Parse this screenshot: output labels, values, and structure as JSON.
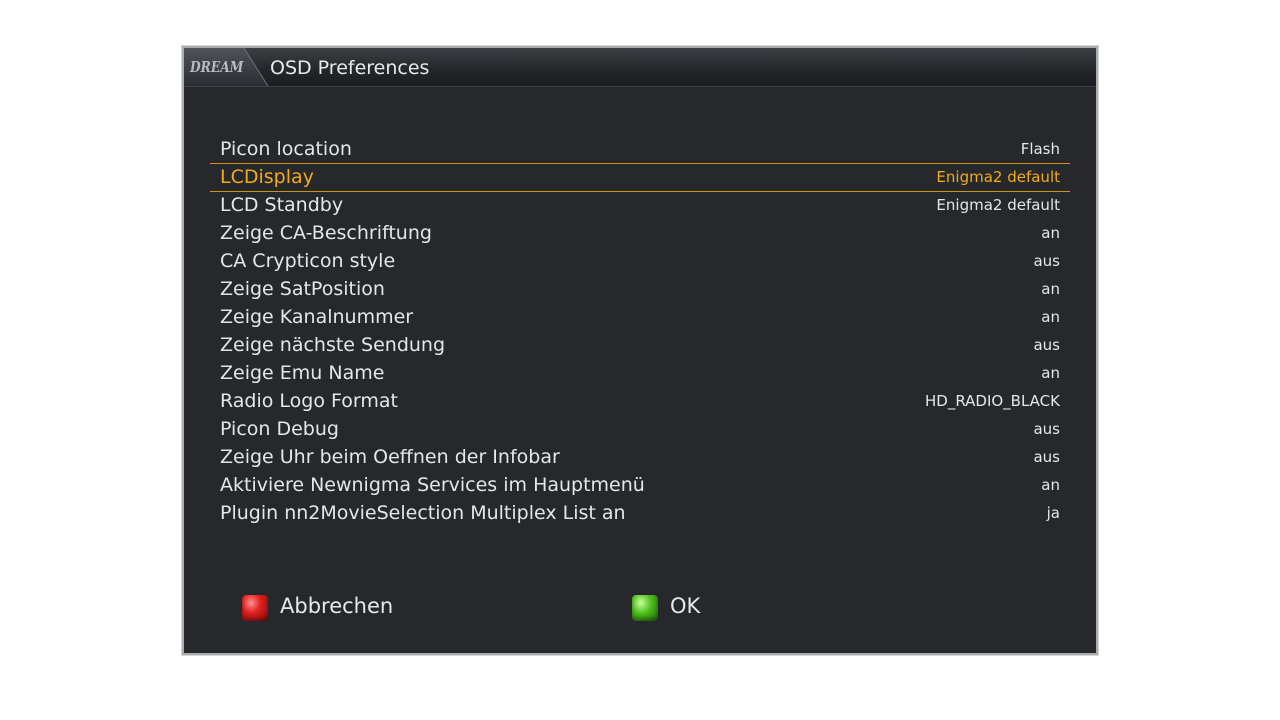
{
  "window": {
    "logo_text": "DREAM",
    "title": "OSD Preferences"
  },
  "settings": [
    {
      "label": "Picon location",
      "value": "Flash"
    },
    {
      "label": "LCDisplay",
      "value": "Enigma2 default",
      "selected": true
    },
    {
      "label": "LCD Standby",
      "value": "Enigma2 default"
    },
    {
      "label": "Zeige CA-Beschriftung",
      "value": "an"
    },
    {
      "label": "CA Crypticon style",
      "value": "aus"
    },
    {
      "label": "Zeige SatPosition",
      "value": "an"
    },
    {
      "label": "Zeige Kanalnummer",
      "value": "an"
    },
    {
      "label": "Zeige nächste Sendung",
      "value": "aus"
    },
    {
      "label": "Zeige Emu Name",
      "value": "an"
    },
    {
      "label": "Radio Logo Format",
      "value": "HD_RADIO_BLACK"
    },
    {
      "label": "Picon Debug",
      "value": "aus"
    },
    {
      "label": "Zeige Uhr beim Oeffnen der Infobar",
      "value": "aus"
    },
    {
      "label": "Aktiviere Newnigma Services im Hauptmenü",
      "value": "an"
    },
    {
      "label": "Plugin nn2MovieSelection Multiplex List an",
      "value": "ja"
    }
  ],
  "footer": {
    "cancel": {
      "label": "Abbrechen",
      "icon": "red-key-icon",
      "color": "#d41c1c"
    },
    "ok": {
      "label": "OK",
      "icon": "green-key-icon",
      "color": "#43b31a"
    }
  },
  "colors": {
    "background": "#26282c",
    "text": "#e6e6e6",
    "selected": "#f2ab12"
  }
}
